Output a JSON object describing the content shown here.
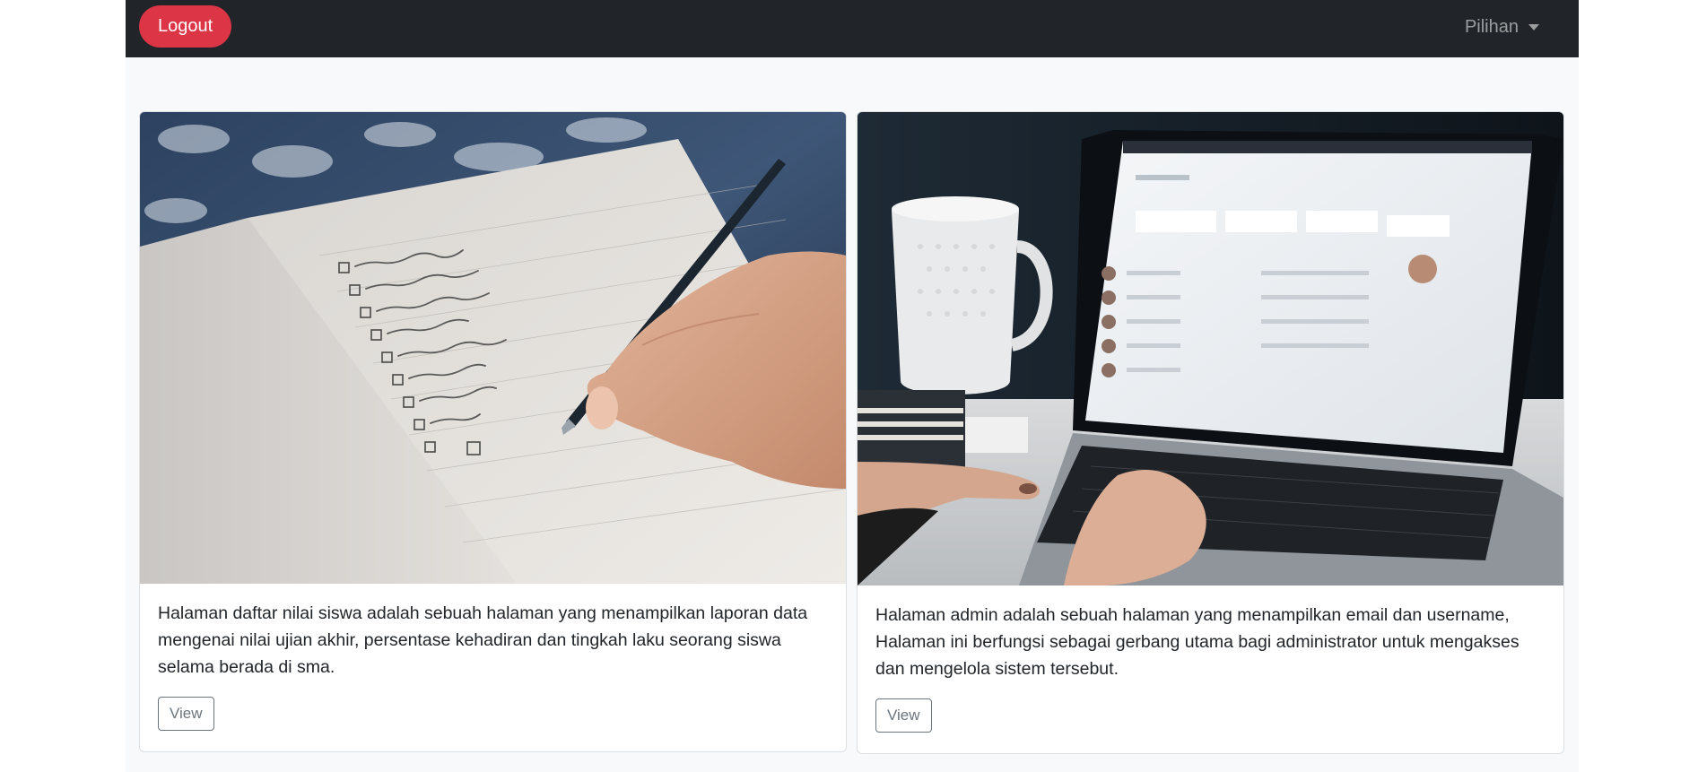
{
  "navbar": {
    "logout_label": "Logout",
    "dropdown_label": "Pilihan"
  },
  "cards": [
    {
      "image": "notebook-checklist-writing-photo",
      "text": "Halaman daftar nilai siswa adalah sebuah halaman yang menampilkan laporan data mengenai nilai ujian akhir, persentase kehadiran dan tingkah laku seorang siswa selama berada di sma.",
      "button_label": "View"
    },
    {
      "image": "laptop-typing-coffee-mug-photo",
      "text": "Halaman admin adalah sebuah halaman yang menampilkan email dan username, Halaman ini berfungsi sebagai gerbang utama bagi administrator untuk mengakses dan mengelola sistem tersebut.",
      "button_label": "View"
    }
  ],
  "colors": {
    "navbar_bg": "#212529",
    "logout_bg": "#dc3545",
    "page_bg": "#f8f9fa",
    "button_outline": "#6c757d"
  }
}
